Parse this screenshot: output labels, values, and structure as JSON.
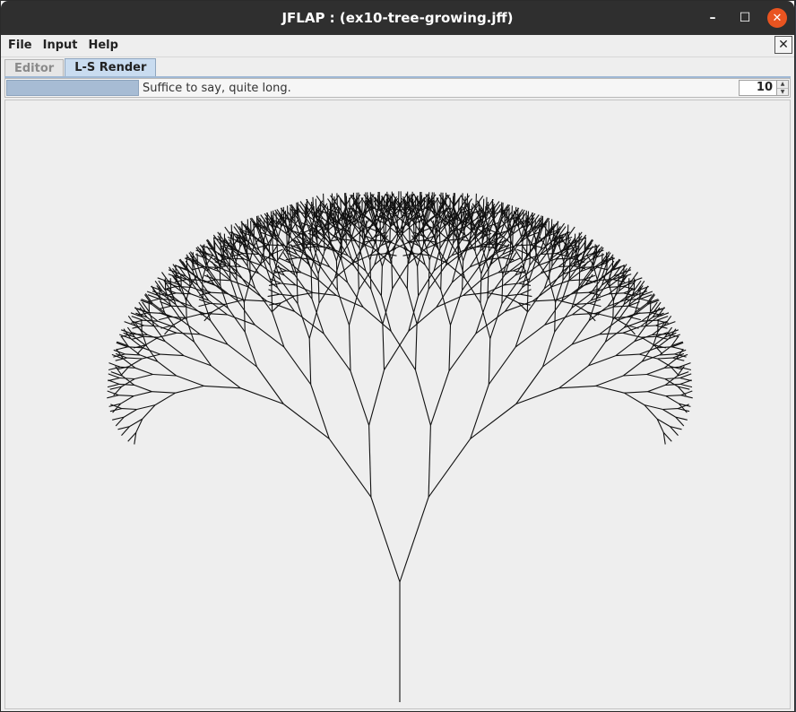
{
  "window": {
    "title": "JFLAP : (ex10-tree-growing.jff)",
    "controls": {
      "minimize": "–",
      "maximize": "☐",
      "close": "✕"
    }
  },
  "menu": {
    "items": [
      "File",
      "Input",
      "Help"
    ],
    "close_glyph": "✕"
  },
  "tabs": [
    {
      "label": "Editor",
      "active": false
    },
    {
      "label": "L-S Render",
      "active": true
    }
  ],
  "render_controls": {
    "status": "Suffice to say, quite long.",
    "recursion_depth": "10",
    "progress_color": "#a7bcd4"
  },
  "render": {
    "depth": 10,
    "stroke_color": "#111111"
  }
}
